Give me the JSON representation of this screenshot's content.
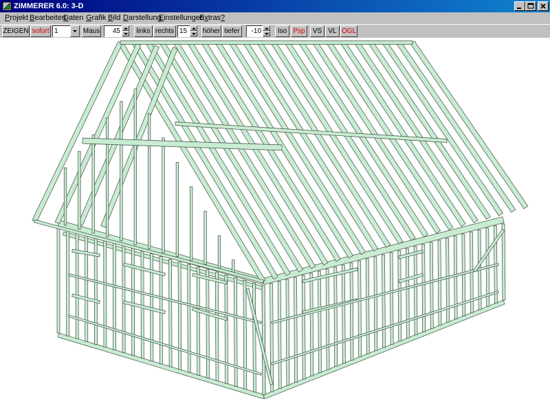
{
  "window": {
    "title": "ZIMMERER 6.0: 3-D"
  },
  "menu": [
    {
      "label": "Projekt",
      "u": "P",
      "rest": "rojekt"
    },
    {
      "label": "Bearbeiten",
      "u": "B",
      "rest": "earbeiten"
    },
    {
      "label": "Daten",
      "u": "D",
      "rest": "aten"
    },
    {
      "label": "Grafik",
      "u": "G",
      "rest": "rafik"
    },
    {
      "label": "Bild",
      "u": "B",
      "rest": "ild"
    },
    {
      "label": "Darstellung",
      "u": "D",
      "rest": "arstellung"
    },
    {
      "label": "Einstellungen",
      "u": "E",
      "rest": "instellungen"
    },
    {
      "label": "Extras",
      "u": "x",
      "pre": "E",
      "rest": "tras"
    },
    {
      "label": "?",
      "u": "?",
      "rest": ""
    }
  ],
  "toolbar": {
    "zeigen": "ZEIGEN",
    "sofort": "sofort",
    "mode_value": "1",
    "maus": "Maus",
    "angle_value": "45",
    "links": "links",
    "rechts": "rechts",
    "step_value": "15",
    "hoeher": "höher",
    "tiefer": "tiefer",
    "height_value": "-10",
    "iso": "Iso",
    "psp": "Psp",
    "vs": "VS",
    "vl": "VL",
    "ogl": "OGL"
  },
  "colors": {
    "timber": "#c8ecd2",
    "timber_edge": "#3c4a40",
    "title_bar": "#000080",
    "active_red": "#e00000"
  },
  "icons": {
    "app": "ruler-triangle-icon",
    "minimize": "minimize-icon",
    "maximize": "maximize-icon",
    "close": "close-icon"
  }
}
